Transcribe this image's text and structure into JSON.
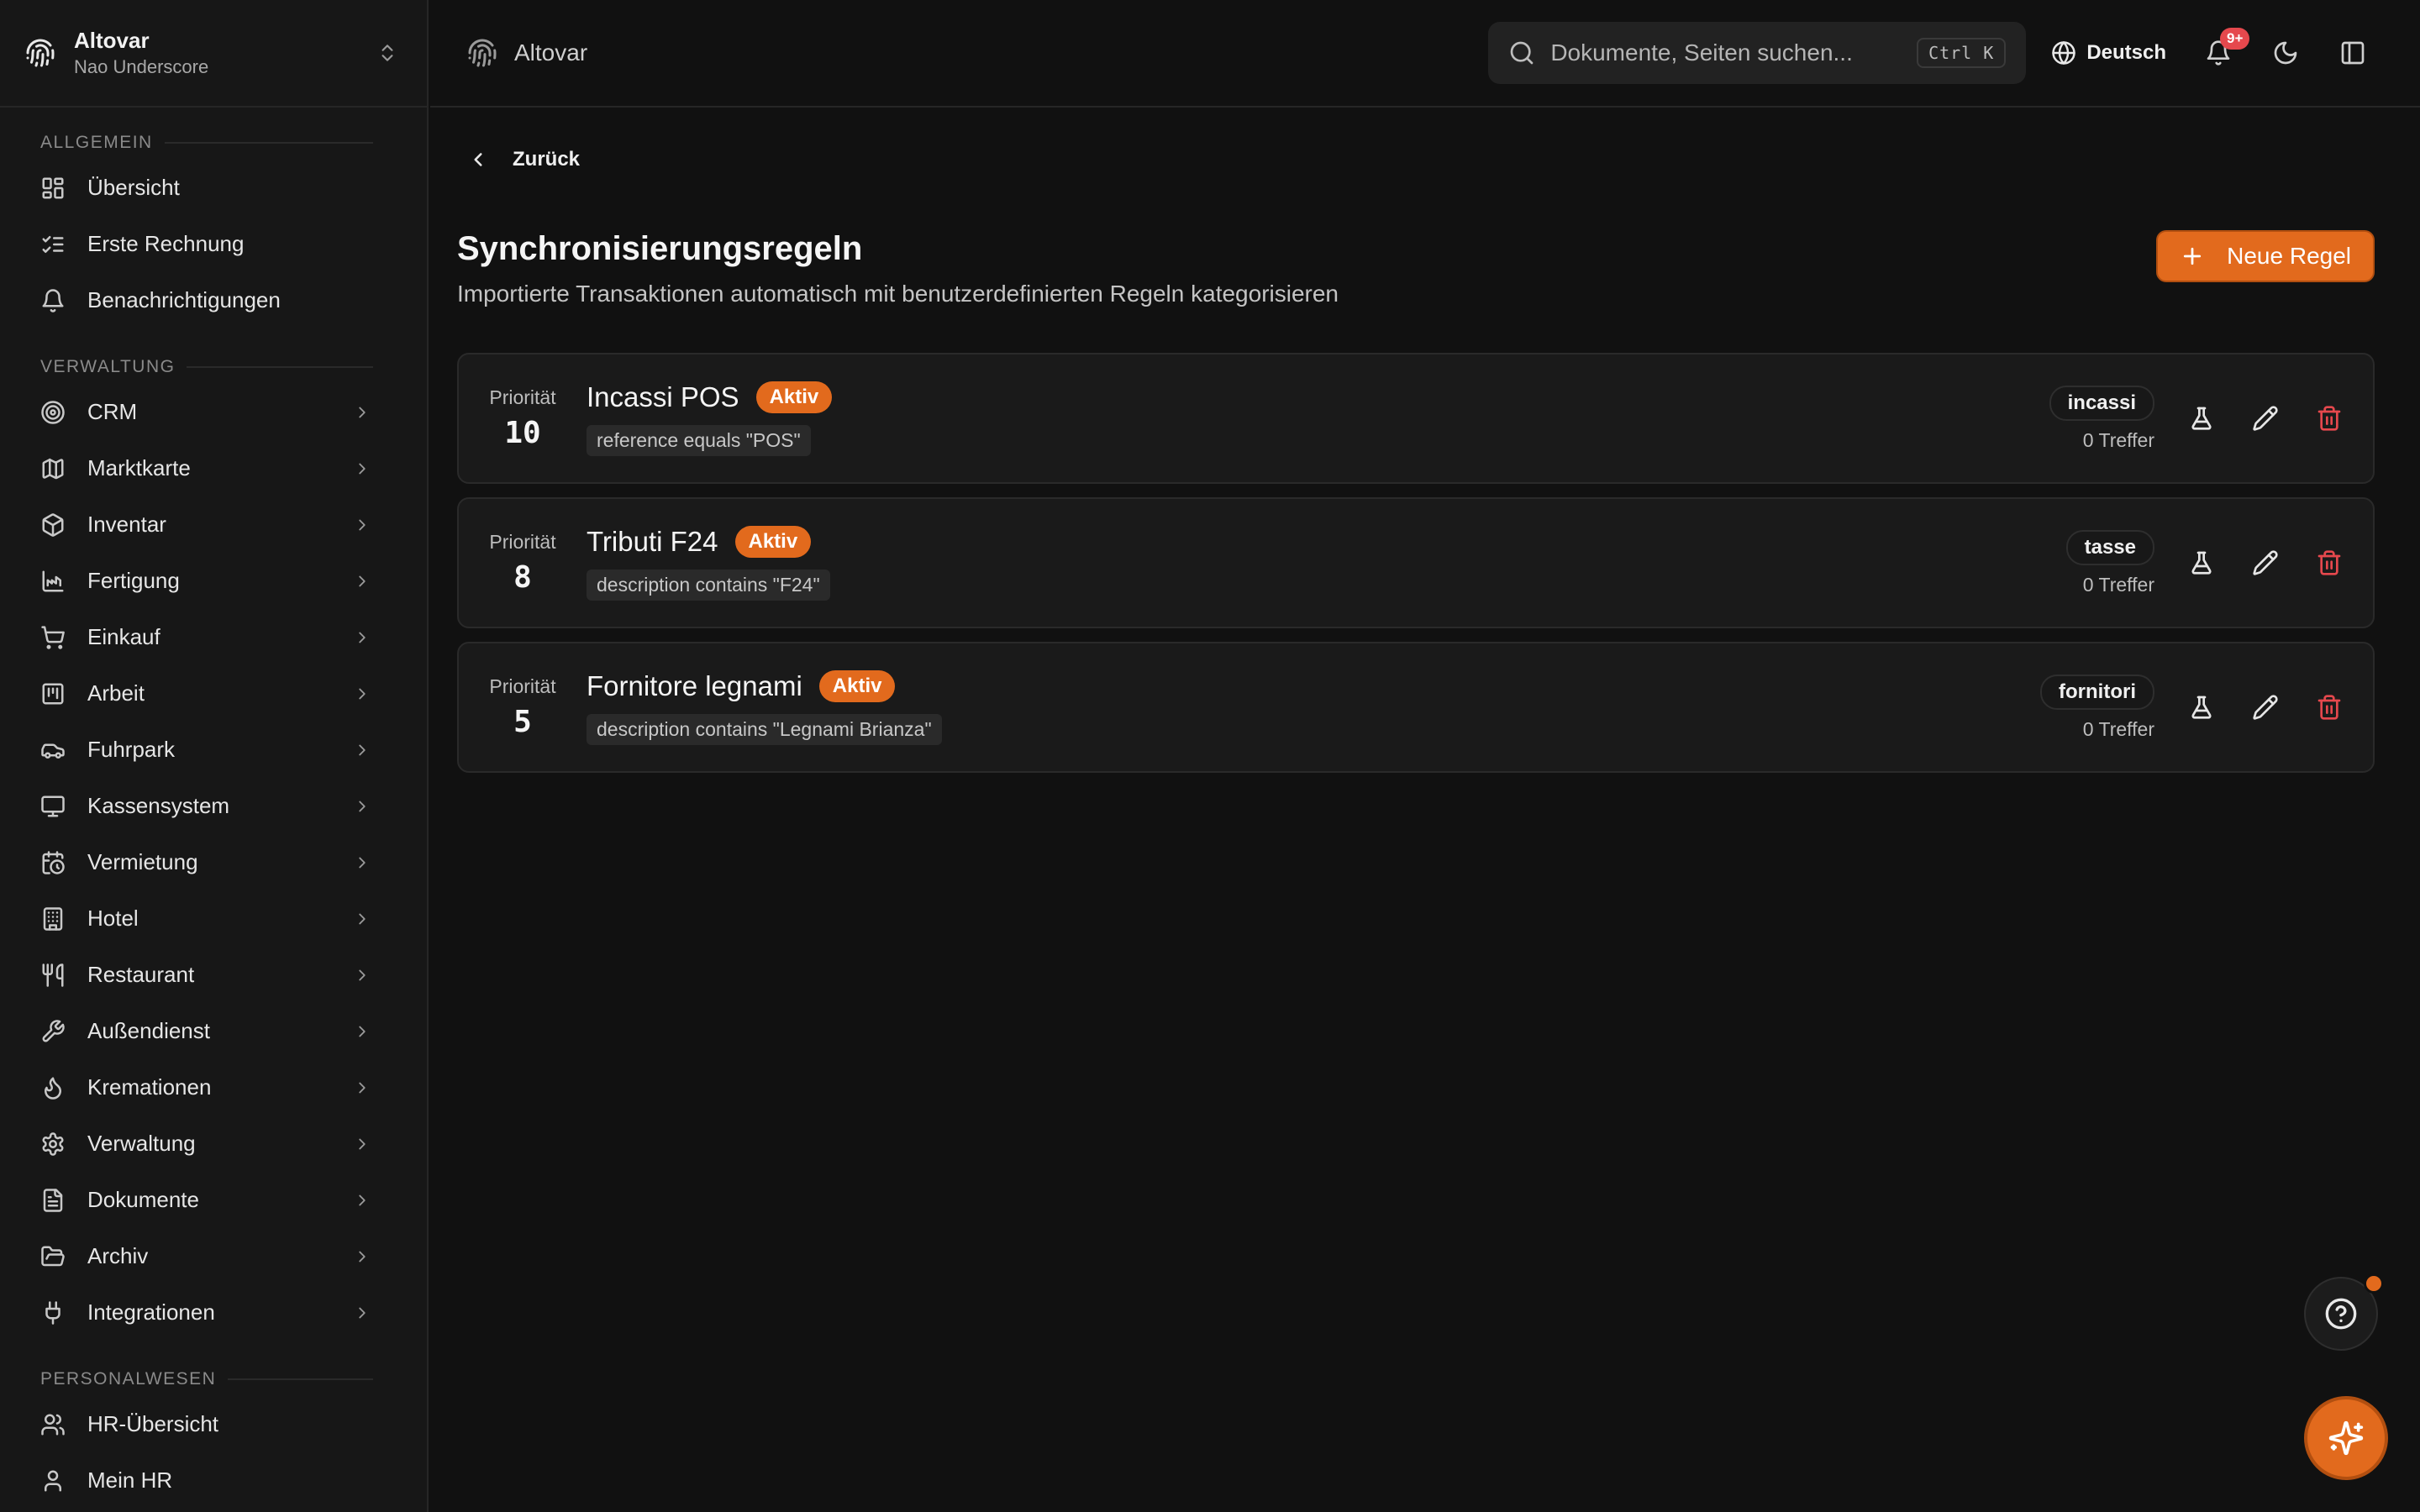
{
  "org": {
    "name": "Altovar",
    "user": "Nao Underscore"
  },
  "topbar": {
    "brand": "Altovar",
    "search_placeholder": "Dokumente, Seiten suchen...",
    "shortcut": "Ctrl K",
    "language": "Deutsch",
    "notifications_badge": "9+"
  },
  "sidebar": {
    "sections": [
      {
        "title": "Allgemein"
      },
      {
        "title": "Verwaltung"
      },
      {
        "title": "Personalwesen"
      }
    ],
    "general": [
      {
        "label": "Übersicht"
      },
      {
        "label": "Erste Rechnung"
      },
      {
        "label": "Benachrichtigungen"
      }
    ],
    "admin": [
      {
        "label": "CRM"
      },
      {
        "label": "Marktkarte"
      },
      {
        "label": "Inventar"
      },
      {
        "label": "Fertigung"
      },
      {
        "label": "Einkauf"
      },
      {
        "label": "Arbeit"
      },
      {
        "label": "Fuhrpark"
      },
      {
        "label": "Kassensystem"
      },
      {
        "label": "Vermietung"
      },
      {
        "label": "Hotel"
      },
      {
        "label": "Restaurant"
      },
      {
        "label": "Außendienst"
      },
      {
        "label": "Kremationen"
      },
      {
        "label": "Verwaltung"
      },
      {
        "label": "Dokumente"
      },
      {
        "label": "Archiv"
      },
      {
        "label": "Integrationen"
      }
    ],
    "hr": [
      {
        "label": "HR-Übersicht"
      },
      {
        "label": "Mein HR"
      }
    ]
  },
  "main": {
    "back_label": "Zurück",
    "title": "Synchronisierungsregeln",
    "subtitle": "Importierte Transaktionen automatisch mit benutzerdefinierten Regeln kategorisieren",
    "new_rule_label": "Neue Regel",
    "priority_label": "Priorität",
    "rules": [
      {
        "priority": "10",
        "name": "Incassi POS",
        "status": "Aktiv",
        "condition": "reference equals \"POS\"",
        "category": "incassi",
        "hits": "0 Treffer"
      },
      {
        "priority": "8",
        "name": "Tributi F24",
        "status": "Aktiv",
        "condition": "description contains \"F24\"",
        "category": "tasse",
        "hits": "0 Treffer"
      },
      {
        "priority": "5",
        "name": "Fornitore legnami",
        "status": "Aktiv",
        "condition": "description contains \"Legnami Brianza\"",
        "category": "fornitori",
        "hits": "0 Treffer"
      }
    ]
  },
  "colors": {
    "accent": "#e26a1d",
    "danger": "#e5484d",
    "background": "#111111"
  },
  "icons": {
    "sidebar_general": [
      "dashboard-icon",
      "checklist-icon",
      "bell-icon"
    ],
    "sidebar_admin": [
      "target-icon",
      "map-icon",
      "box-icon",
      "factory-icon",
      "cart-icon",
      "kanban-icon",
      "car-icon",
      "monitor-icon",
      "calendar-clock-icon",
      "building-icon",
      "utensils-icon",
      "wrench-icon",
      "flame-icon",
      "gear-icon",
      "file-icon",
      "folder-open-icon",
      "plug-icon"
    ],
    "sidebar_hr": [
      "users-icon",
      "user-icon"
    ]
  }
}
